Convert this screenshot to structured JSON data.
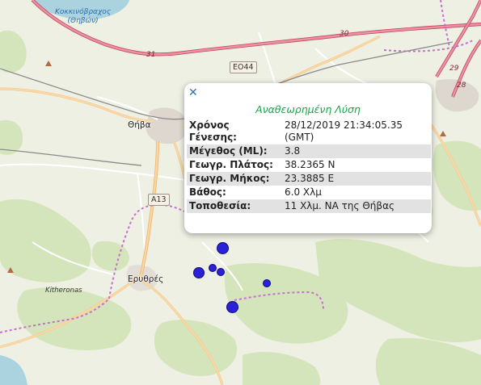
{
  "map": {
    "places": {
      "lake": "Κοκκινόβραχος\n(Θηβών)",
      "thiva": "Θήβα",
      "erythres": "Ερυθρές",
      "kitheronas": "Kitheronas"
    },
    "road_numbers": {
      "r31": "31",
      "r30": "30",
      "r29": "29",
      "r28": "28",
      "eo44": "ΕΟ44",
      "a13": "A13"
    },
    "colors": {
      "land": "#eef0e4",
      "forest": "#d4e5bc",
      "water": "#aad3df",
      "motorway": "#e892a2",
      "primary": "#f9d9a7",
      "railway": "#8a8a8a",
      "admin_boundary": "#c86ed0",
      "quake_marker": "#2b21d6"
    },
    "earthquakes_visible": 6
  },
  "popup": {
    "close_icon": "close-icon",
    "title": "Αναθεωρημένη Λύση",
    "rows": [
      {
        "label": "Χρόνος Γένεσης:",
        "value": "28/12/2019 21:34:05.35 (GMT)"
      },
      {
        "label": "Μέγεθος (ML):",
        "value": "3.8"
      },
      {
        "label": "Γεωγρ. Πλάτος:",
        "value": "38.2365 N"
      },
      {
        "label": "Γεωγρ. Μήκος:",
        "value": "23.3885 E"
      },
      {
        "label": "Βάθος:",
        "value": "6.0 Χλμ"
      },
      {
        "label": "Τοποθεσία:",
        "value": "11 Χλμ. ΝΑ της Θήβας"
      }
    ]
  }
}
